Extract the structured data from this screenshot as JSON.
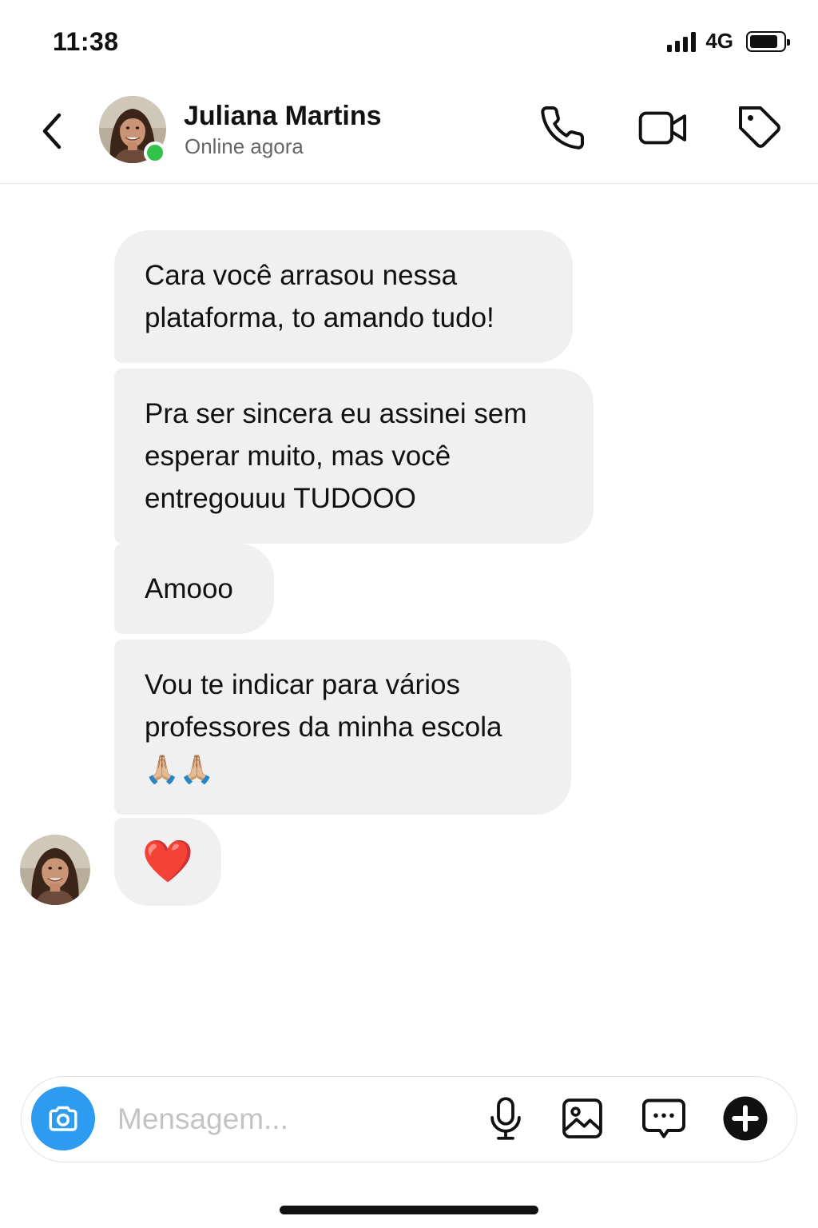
{
  "status_bar": {
    "time": "11:38",
    "network": "4G"
  },
  "header": {
    "contact_name": "Juliana Martins",
    "contact_status": "Online agora",
    "online_color": "#31c24a",
    "icons": [
      "back-chevron-icon",
      "phone-icon",
      "video-camera-icon",
      "tag-icon"
    ]
  },
  "messages": [
    {
      "text": "Cara você arrasou nessa plataforma, to amando tudo!"
    },
    {
      "text": "Pra ser sincera eu assinei sem esperar muito, mas você entregouuu TUDOOO"
    },
    {
      "text": "Amooo"
    },
    {
      "text": "Vou te indicar para vários professores da minha escola 🙏🏼🙏🏼"
    },
    {
      "text": "❤️"
    }
  ],
  "composer": {
    "placeholder": "Mensagem...",
    "accent_color": "#2d9bf0",
    "icons": [
      "camera-icon",
      "microphone-icon",
      "image-icon",
      "chat-bubble-icon",
      "plus-icon"
    ]
  }
}
